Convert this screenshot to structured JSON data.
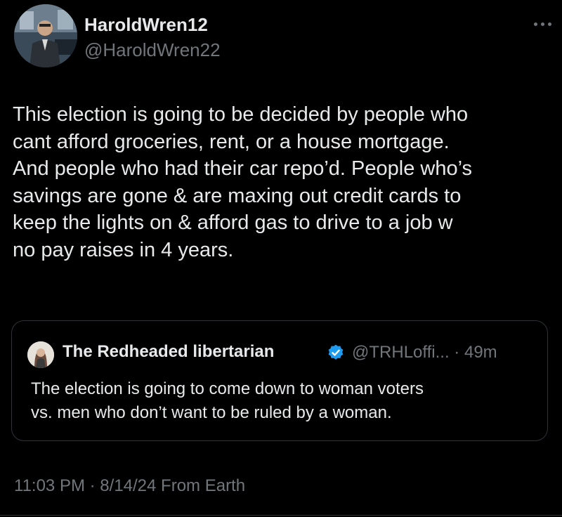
{
  "author": {
    "display_name": "HaroldWren12",
    "handle": "@HaroldWren22",
    "avatar_icon": "profile-photo-man-at-desk"
  },
  "more_icon": "more-options-icon",
  "tweet": {
    "lines": [
      "This election is going to be decided by people who",
      "cant afford groceries, rent, or a house mortgage.",
      "And people who had their car repo’d. People who’s",
      "savings are gone & are maxing out credit cards to",
      "keep the lights on & afford gas to drive to a job w",
      "no pay raises in 4 years."
    ]
  },
  "quoted_tweet": {
    "display_name": "The Redheaded libertarian",
    "verified": true,
    "handle": "@TRHLoffi...",
    "separator": "·",
    "time_ago": "49m",
    "lines": [
      "The election is going to come down to woman voters",
      "vs. men who don’t want to be ruled by a woman."
    ]
  },
  "meta": {
    "time": "11:03 PM",
    "separator": "·",
    "date": "8/14/24",
    "source": "From Earth"
  },
  "colors": {
    "background": "#000000",
    "primary_text": "#e7e9ea",
    "secondary_text": "#71767b",
    "border": "#2f3336",
    "verified_blue": "#1d9bf0"
  }
}
